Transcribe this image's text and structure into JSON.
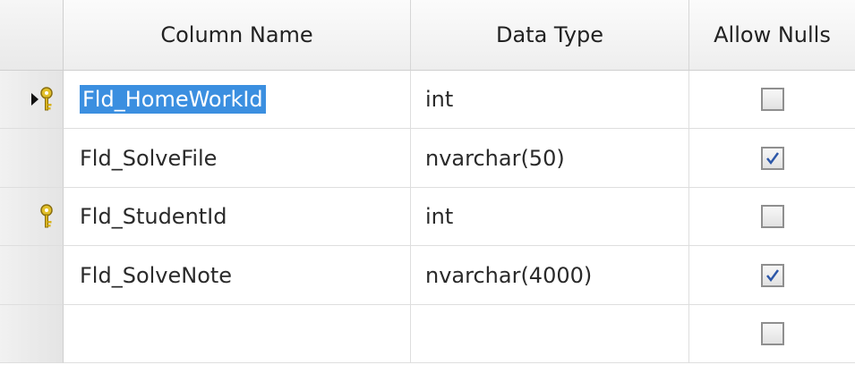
{
  "headers": {
    "column_name": "Column Name",
    "data_type": "Data Type",
    "allow_nulls": "Allow Nulls"
  },
  "rows": [
    {
      "name": "Fld_HomeWorkId",
      "type": "int",
      "allow_nulls": false,
      "primary_key": true,
      "current": true,
      "selected": true
    },
    {
      "name": "Fld_SolveFile",
      "type": "nvarchar(50)",
      "allow_nulls": true,
      "primary_key": false,
      "current": false,
      "selected": false
    },
    {
      "name": "Fld_StudentId",
      "type": "int",
      "allow_nulls": false,
      "primary_key": true,
      "current": false,
      "selected": false
    },
    {
      "name": "Fld_SolveNote",
      "type": "nvarchar(4000)",
      "allow_nulls": true,
      "primary_key": false,
      "current": false,
      "selected": false
    },
    {
      "name": "",
      "type": "",
      "allow_nulls": false,
      "primary_key": false,
      "current": false,
      "selected": false
    }
  ],
  "icons": {
    "primary_key": "key-icon",
    "current_row": "row-pointer-icon",
    "checked": "checkmark-icon"
  },
  "colors": {
    "selection": "#3b8fe0",
    "key": "#d8b21a",
    "checkmark": "#2c57a8"
  }
}
